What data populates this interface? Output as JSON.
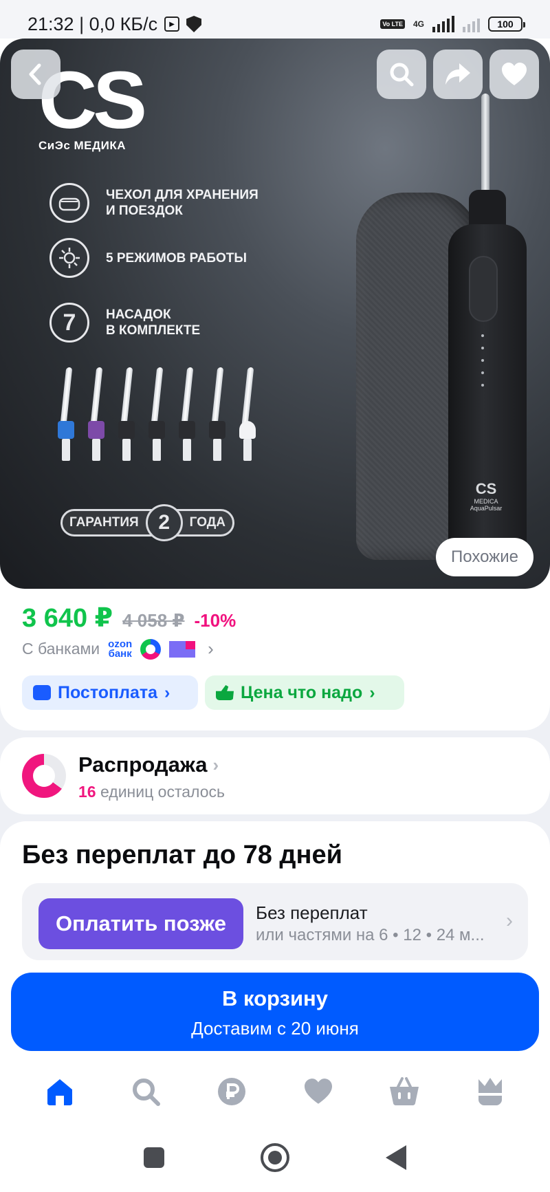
{
  "status_bar": {
    "time": "21:32 | 0,0 КБ/с",
    "network": "4G",
    "volte": "Vo LTE",
    "battery": "100"
  },
  "product": {
    "brand_logo": "CS",
    "brand_sub": "СиЭс МЕДИКА",
    "features": [
      {
        "icon": "case-icon",
        "text": "ЧЕХОЛ ДЛЯ ХРАНЕНИЯ\nИ ПОЕЗДОК"
      },
      {
        "icon": "modes-icon",
        "text": "5 РЕЖИМОВ РАБОТЫ"
      },
      {
        "icon": "seven-icon",
        "text": "НАСАДОК\nВ КОМПЛЕКТЕ",
        "badge": "7"
      }
    ],
    "warranty": {
      "left": "ГАРАНТИЯ",
      "number": "2",
      "right": "ГОДА"
    },
    "device_brand": "CS",
    "device_brand_sub": "MEDICA",
    "device_model": "AquaPulsar",
    "similar_label": "Похожие",
    "nozzle_colors": [
      "#2f78d8",
      "#7d4aa8",
      "#2b2c30",
      "#2b2c30",
      "#2b2c30",
      "#2b2c30",
      "#f2f3f5"
    ]
  },
  "price": {
    "current": "3 640 ₽",
    "old": "4 058 ₽",
    "discount": "-10%",
    "banks_label": "С банками",
    "ozon_bank": "ozon\nбанк"
  },
  "chips": {
    "postpay": "Постоплата",
    "price_ok": "Цена что надо"
  },
  "sale": {
    "title": "Распродажа",
    "count": "16",
    "remaining": "единиц осталось"
  },
  "installments": {
    "title": "Без переплат до 78 дней",
    "pay_later": "Оплатить позже",
    "line1": "Без переплат",
    "line2": "или частями на 6 • 12 • 24 м..."
  },
  "cart": {
    "label": "В корзину",
    "delivery": "Доставим с 20 июня"
  },
  "colors": {
    "accent": "#005bff",
    "price_green": "#10c44c",
    "discount_pink": "#f1117e",
    "pay_later_purple": "#6c4fe0"
  }
}
